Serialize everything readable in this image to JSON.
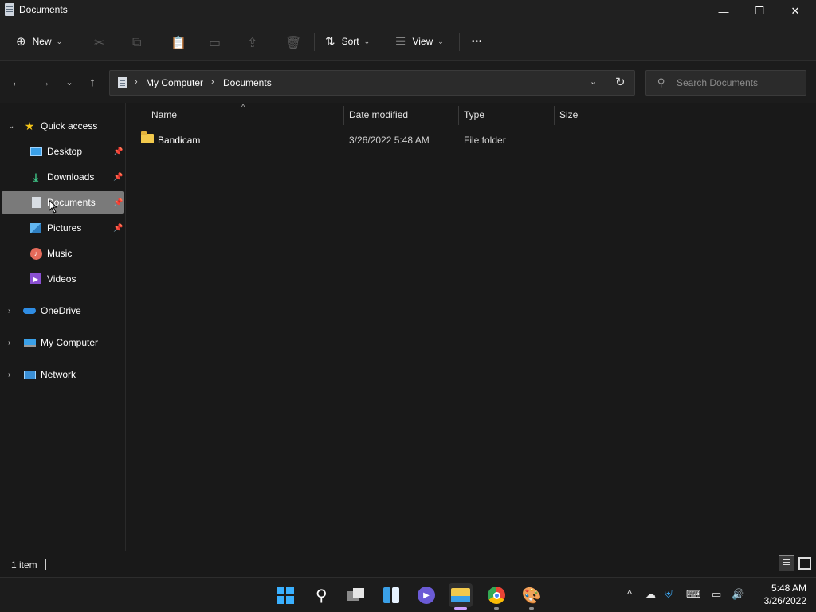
{
  "window": {
    "title": "Documents",
    "minimize_glyph": "—",
    "maximize_glyph": "❐",
    "close_glyph": "✕"
  },
  "toolbar": {
    "new_label": "New",
    "sort_label": "Sort",
    "view_label": "View",
    "more_glyph": "•••"
  },
  "address": {
    "crumbs": [
      "My Computer",
      "Documents"
    ],
    "search_placeholder": "Search Documents"
  },
  "sidebar": {
    "quick_access": "Quick access",
    "items": [
      {
        "label": "Desktop",
        "icon": "desktop-icon",
        "pinned": true
      },
      {
        "label": "Downloads",
        "icon": "download-icon",
        "pinned": true
      },
      {
        "label": "Documents",
        "icon": "documents-icon",
        "pinned": true,
        "selected": true
      },
      {
        "label": "Pictures",
        "icon": "pictures-icon",
        "pinned": true
      },
      {
        "label": "Music",
        "icon": "music-icon",
        "pinned": false
      },
      {
        "label": "Videos",
        "icon": "videos-icon",
        "pinned": false
      }
    ],
    "roots": [
      {
        "label": "OneDrive",
        "icon": "cloud-icon"
      },
      {
        "label": "My Computer",
        "icon": "computer-icon"
      },
      {
        "label": "Network",
        "icon": "network-icon"
      }
    ]
  },
  "columns": {
    "name": "Name",
    "date": "Date modified",
    "type": "Type",
    "size": "Size"
  },
  "files": [
    {
      "name": "Bandicam",
      "date": "3/26/2022 5:48 AM",
      "type": "File folder",
      "size": ""
    }
  ],
  "status": {
    "count": "1 item"
  },
  "clock": {
    "time": "5:48 AM",
    "date": "3/26/2022"
  },
  "colors": {
    "accent": "#4cc2ff",
    "folder": "#f2c94c",
    "background": "#191919",
    "selection": "#7a7a7a"
  }
}
